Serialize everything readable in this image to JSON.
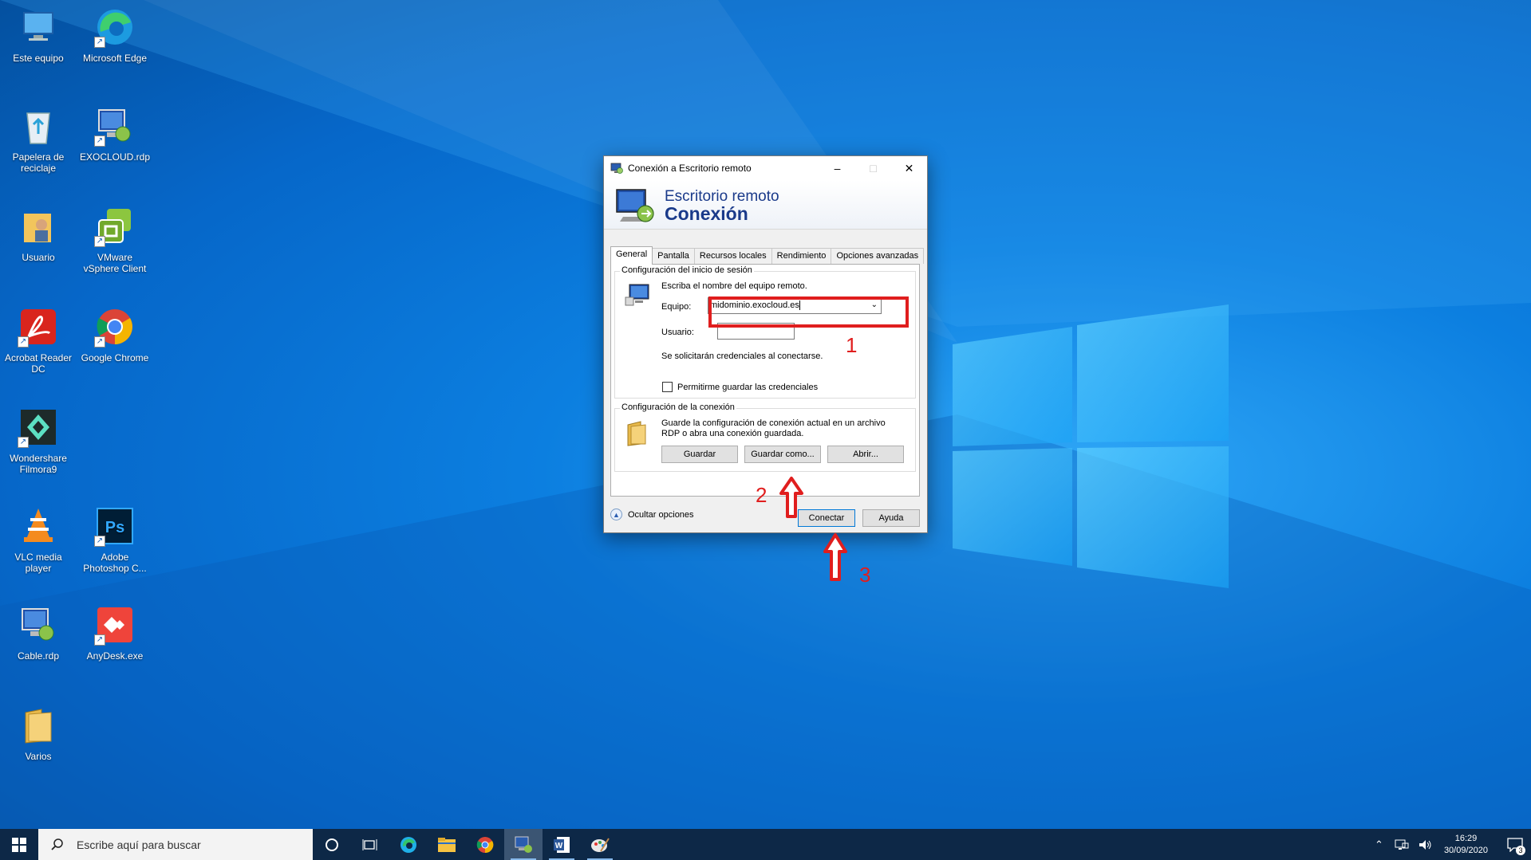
{
  "desktop": {
    "icons": [
      {
        "label": "Este equipo",
        "icon": "this-pc-icon"
      },
      {
        "label": "Microsoft Edge",
        "icon": "edge-icon"
      },
      {
        "label": "Papelera de reciclaje",
        "icon": "recycle-bin-icon"
      },
      {
        "label": "EXOCLOUD.rdp",
        "icon": "rdp-file-icon"
      },
      {
        "label": "Usuario",
        "icon": "user-folder-icon"
      },
      {
        "label": "VMware vSphere Client",
        "icon": "vmware-icon"
      },
      {
        "label": "Acrobat Reader DC",
        "icon": "acrobat-icon"
      },
      {
        "label": "Google Chrome",
        "icon": "chrome-icon"
      },
      {
        "label": "Wondershare Filmora9",
        "icon": "filmora-icon"
      },
      {
        "label": "VLC media player",
        "icon": "vlc-icon"
      },
      {
        "label": "Adobe Photoshop C...",
        "icon": "photoshop-icon"
      },
      {
        "label": "Cable.rdp",
        "icon": "rdp-file-icon"
      },
      {
        "label": "AnyDesk.exe",
        "icon": "anydesk-icon"
      },
      {
        "label": "Varios",
        "icon": "folder-icon"
      }
    ]
  },
  "dialog": {
    "title": "Conexión a Escritorio remoto",
    "banner_line1": "Escritorio remoto",
    "banner_line2": "Conexión",
    "tabs": [
      "General",
      "Pantalla",
      "Recursos locales",
      "Rendimiento",
      "Opciones avanzadas"
    ],
    "login_group": {
      "legend": "Configuración del inicio de sesión",
      "instruction": "Escriba el nombre del equipo remoto.",
      "computer_label": "Equipo:",
      "computer_value": "midominio.exocloud.es",
      "user_label": "Usuario:",
      "user_value": "",
      "credentials_note": "Se solicitarán credenciales al conectarse.",
      "save_credentials_label": "Permitirme guardar las credenciales",
      "save_credentials_checked": false
    },
    "connection_group": {
      "legend": "Configuración de la conexión",
      "description_line1": "Guarde la configuración de conexión actual en un archivo",
      "description_line2": "RDP o abra una conexión guardada.",
      "save_label": "Guardar",
      "save_as_label": "Guardar como...",
      "open_label": "Abrir..."
    },
    "hide_options_label": "Ocultar opciones",
    "connect_label": "Conectar",
    "help_label": "Ayuda"
  },
  "annotations": {
    "n1": "1",
    "n2": "2",
    "n3": "3",
    "color": "#e01e1e"
  },
  "taskbar": {
    "search_placeholder": "Escribe aquí para buscar",
    "apps": [
      "cortana-icon",
      "task-view-icon",
      "edge-icon",
      "file-explorer-icon",
      "chrome-icon",
      "remote-desktop-icon",
      "word-icon",
      "paint-icon"
    ],
    "time": "16:29",
    "date": "30/09/2020",
    "notification_count": "3"
  }
}
